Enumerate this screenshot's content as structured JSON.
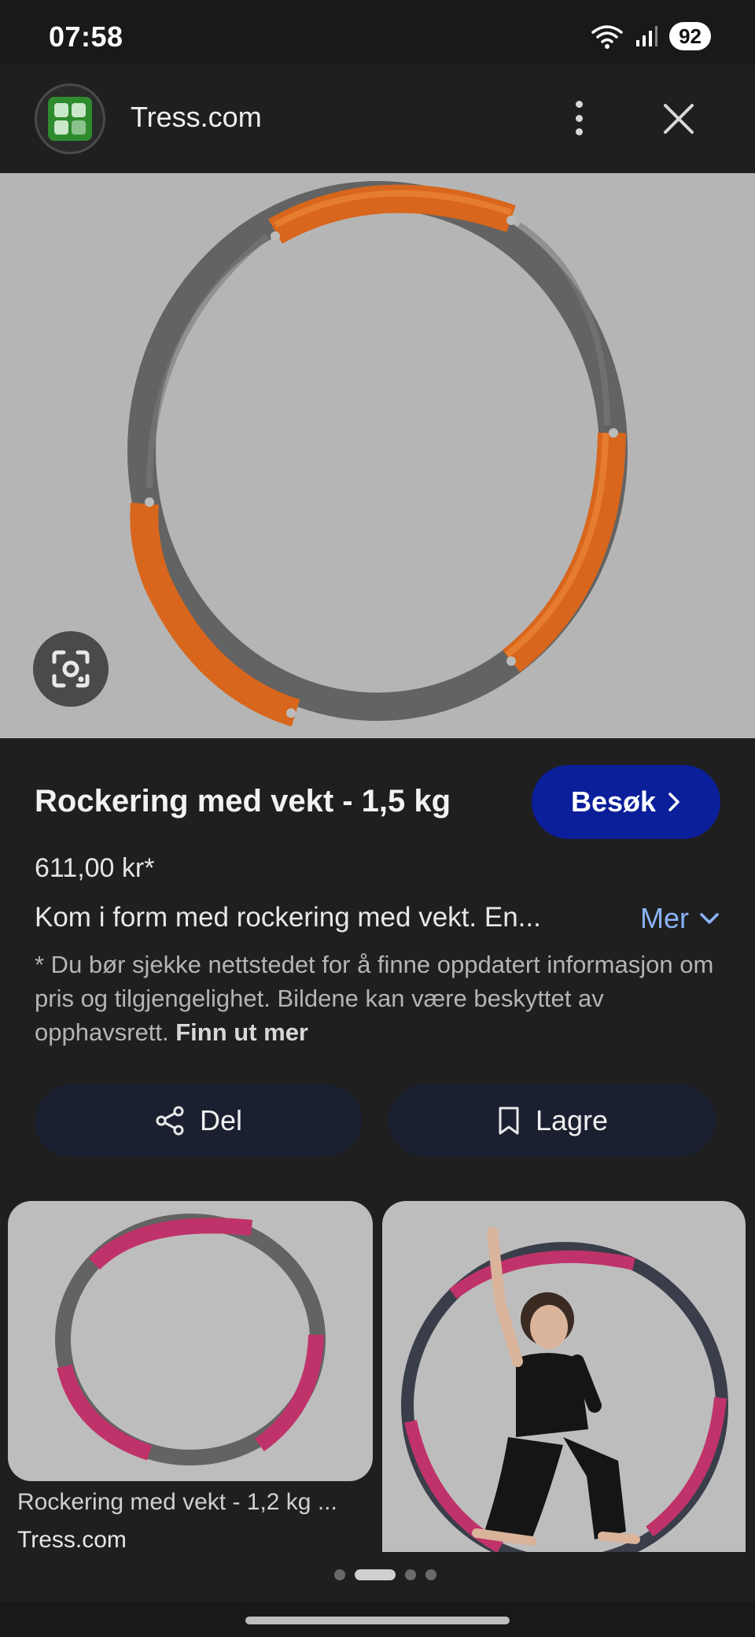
{
  "status_bar": {
    "time": "07:58",
    "battery": "92",
    "icons": [
      "wifi-icon",
      "signal-icon"
    ]
  },
  "header": {
    "site_name": "Tress.com",
    "logo_icon": "site-logo-icon",
    "menu_icon": "more-vert-icon",
    "close_icon": "close-icon"
  },
  "hero": {
    "image": "orange-grey-weighted-hula-hoop",
    "lens_icon": "google-lens-icon"
  },
  "product": {
    "title": "Rockering med vekt - 1,5 kg",
    "visit_label": "Besøk",
    "price": "611,00 kr*",
    "description": "Kom i form med rockering med vekt. En...",
    "more_label": "Mer",
    "disclaimer": "* Du bør sjekke nettstedet for å finne oppdatert informasjon om pris og tilgjengelighet. Bildene kan være beskyttet av opphavsrett.",
    "learn_more": "Finn ut mer"
  },
  "actions": {
    "share_label": "Del",
    "save_label": "Lagre"
  },
  "related": {
    "items": [
      {
        "caption": "Rockering med vekt - 1,2 kg ...",
        "source": "Tress.com",
        "image": "pink-grey-hula-hoop"
      },
      {
        "caption": "",
        "source": "",
        "image": "woman-with-pink-hula-hoop"
      }
    ]
  },
  "pagination": {
    "count": 4,
    "active_index": 1
  },
  "colors": {
    "accent_button": "#0b1f9a",
    "link": "#8ab4f8",
    "background": "#1f1f1f",
    "action_button": "#1a2030"
  }
}
